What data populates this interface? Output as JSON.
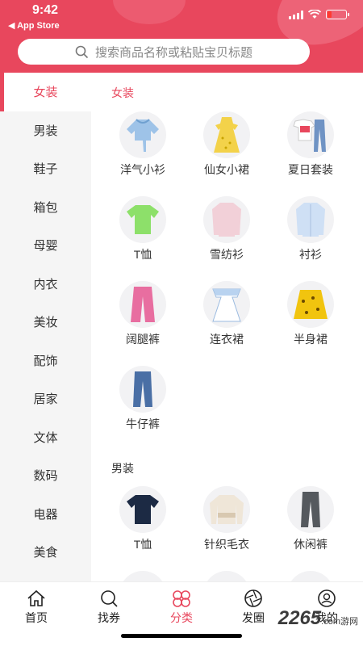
{
  "status_bar": {
    "time": "9:42",
    "back_label": "◀ App Store"
  },
  "search": {
    "placeholder": "搜索商品名称或粘贴宝贝标题"
  },
  "sidebar": {
    "items": [
      {
        "label": "女装",
        "active": true
      },
      {
        "label": "男装"
      },
      {
        "label": "鞋子"
      },
      {
        "label": "箱包"
      },
      {
        "label": "母婴"
      },
      {
        "label": "内衣"
      },
      {
        "label": "美妆"
      },
      {
        "label": "配饰"
      },
      {
        "label": "居家"
      },
      {
        "label": "文体"
      },
      {
        "label": "数码"
      },
      {
        "label": "电器"
      },
      {
        "label": "美食"
      }
    ]
  },
  "sections": [
    {
      "title": "女装",
      "items": [
        {
          "label": "洋气小衫",
          "icon": "blouse-icon"
        },
        {
          "label": "仙女小裙",
          "icon": "dress-icon"
        },
        {
          "label": "夏日套装",
          "icon": "outfit-set-icon"
        },
        {
          "label": "T恤",
          "icon": "tshirt-icon"
        },
        {
          "label": "雪纺衫",
          "icon": "chiffon-shirt-icon"
        },
        {
          "label": "衬衫",
          "icon": "shirt-icon"
        },
        {
          "label": "阔腿裤",
          "icon": "wide-pants-icon"
        },
        {
          "label": "连衣裙",
          "icon": "dress-icon"
        },
        {
          "label": "半身裙",
          "icon": "skirt-icon"
        },
        {
          "label": "牛仔裤",
          "icon": "jeans-icon"
        }
      ]
    },
    {
      "title": "男装",
      "items": [
        {
          "label": "T恤",
          "icon": "tshirt-icon"
        },
        {
          "label": "针织毛衣",
          "icon": "sweater-icon"
        },
        {
          "label": "休闲裤",
          "icon": "pants-icon"
        }
      ]
    }
  ],
  "tabbar": {
    "items": [
      {
        "label": "首页",
        "icon": "home-icon"
      },
      {
        "label": "找券",
        "icon": "search-icon"
      },
      {
        "label": "分类",
        "icon": "category-icon",
        "active": true
      },
      {
        "label": "发圈",
        "icon": "shutter-icon"
      },
      {
        "label": "我的",
        "icon": "profile-icon"
      }
    ]
  },
  "watermark": {
    "text": "2265",
    "sub": ".com游网"
  },
  "colors": {
    "brand": "#e8475d",
    "sidebar_bg": "#f5f5f5"
  }
}
